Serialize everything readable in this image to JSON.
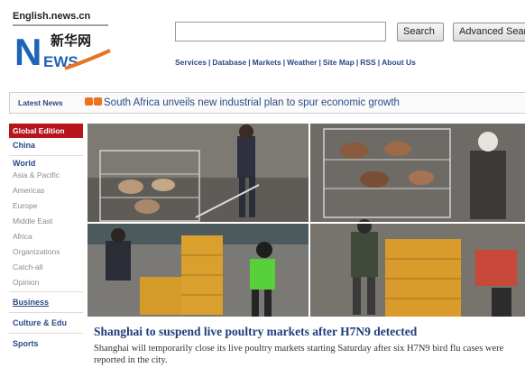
{
  "logo": {
    "site": "English.news.cn",
    "chinese": "新华网",
    "letters": "NEWS",
    "brand_colors": [
      "#1e63b6",
      "#e8741f"
    ]
  },
  "search": {
    "value": "",
    "placeholder": "",
    "button": "Search",
    "advanced_button": "Advanced Search"
  },
  "topnav": [
    "Services",
    "Database",
    "Markets",
    "Weather",
    "Site Map",
    "RSS",
    "About Us"
  ],
  "latest": {
    "label": "Latest News",
    "icon": "double-arrow-icon",
    "text": "South Africa unveils new industrial plan to spur economic growth"
  },
  "sidebar": {
    "edition": "Global Edition",
    "china": "China",
    "world": "World",
    "world_items": [
      "Asia & Pacific",
      "Americas",
      "Europe",
      "Middle East",
      "Africa",
      "Organizations",
      "Catch-all",
      "Opinion"
    ],
    "business": "Business",
    "culture": "Culture & Edu",
    "sports": "Sports"
  },
  "article": {
    "headline": "Shanghai to suspend live poultry markets after H7N9 detected",
    "summary": "Shanghai will temporarily close its live poultry markets starting Saturday after six H7N9 bird flu cases were reported in the city."
  },
  "colors": {
    "accent_red": "#b8141c",
    "link_blue": "#2a4a85",
    "headline_blue": "#1d3d7a"
  }
}
